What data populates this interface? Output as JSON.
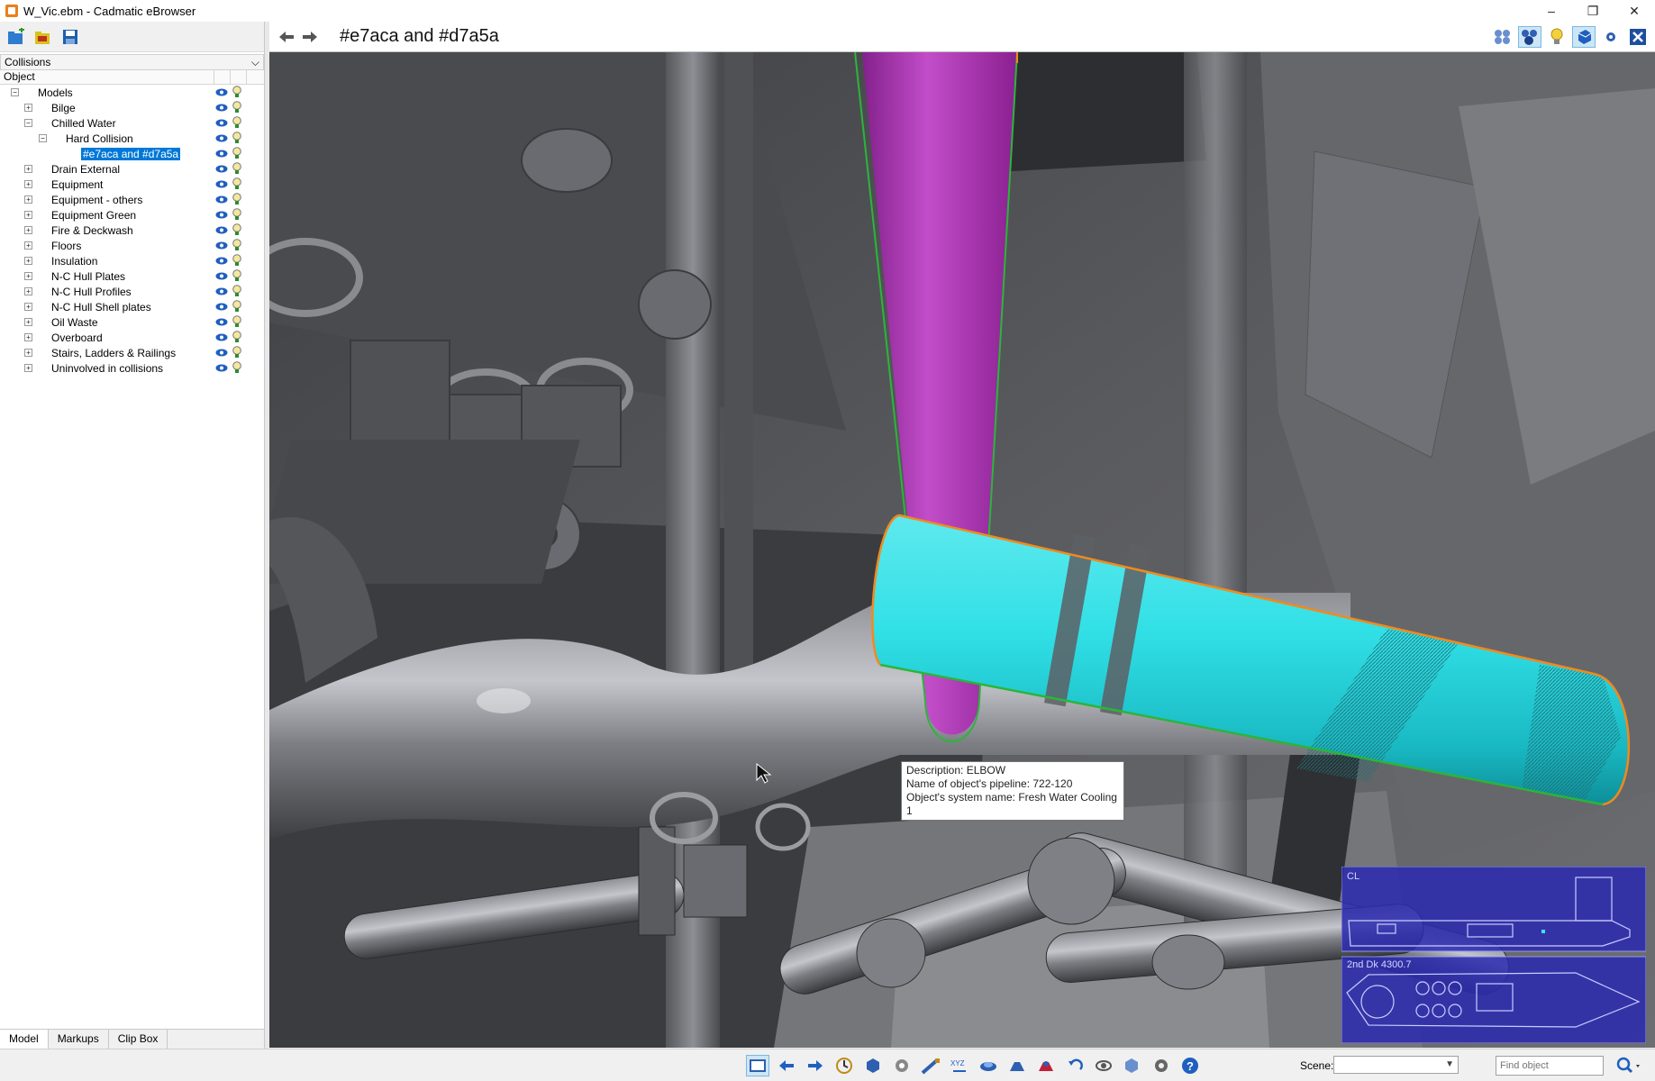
{
  "window": {
    "title": "W_Vic.ebm - Cadmatic eBrowser",
    "minimize": "–",
    "restore": "❐",
    "close": "✕"
  },
  "left_panel": {
    "dropdown_value": "Collisions",
    "column_header": "Object",
    "tree": [
      {
        "label": "Models",
        "level": 0,
        "expander": "−"
      },
      {
        "label": "Bilge",
        "level": 1,
        "expander": "+"
      },
      {
        "label": "Chilled Water",
        "level": 1,
        "expander": "−"
      },
      {
        "label": "Hard Collision",
        "level": 2,
        "expander": "−"
      },
      {
        "label": "#e7aca and #d7a5a",
        "level": 3,
        "expander": "",
        "selected": true
      },
      {
        "label": "Drain External",
        "level": 1,
        "expander": "+"
      },
      {
        "label": "Equipment",
        "level": 1,
        "expander": "+"
      },
      {
        "label": "Equipment - others",
        "level": 1,
        "expander": "+"
      },
      {
        "label": "Equipment Green",
        "level": 1,
        "expander": "+"
      },
      {
        "label": "Fire & Deckwash",
        "level": 1,
        "expander": "+"
      },
      {
        "label": "Floors",
        "level": 1,
        "expander": "+"
      },
      {
        "label": "Insulation",
        "level": 1,
        "expander": "+"
      },
      {
        "label": "N-C Hull Plates",
        "level": 1,
        "expander": "+"
      },
      {
        "label": "N-C Hull Profiles",
        "level": 1,
        "expander": "+"
      },
      {
        "label": "N-C Hull Shell plates",
        "level": 1,
        "expander": "+"
      },
      {
        "label": "Oil Waste",
        "level": 1,
        "expander": "+"
      },
      {
        "label": "Overboard",
        "level": 1,
        "expander": "+"
      },
      {
        "label": "Stairs, Ladders & Railings",
        "level": 1,
        "expander": "+"
      },
      {
        "label": "Uninvolved in collisions",
        "level": 1,
        "expander": "+"
      }
    ],
    "tabs": [
      "Model",
      "Markups",
      "Clip Box"
    ]
  },
  "view": {
    "title": "#e7aca and #d7a5a"
  },
  "tooltip": {
    "line1": "Description: ELBOW",
    "line2": "Name of object's pipeline: 722-120",
    "line3": "Object's system name: Fresh Water Cooling 1"
  },
  "minimap": {
    "label_top": "CL",
    "label_bottom": "2nd Dk  4300.7"
  },
  "status_bar": {
    "scene_label": "Scene:",
    "scene_value": "",
    "find_placeholder": "Find object"
  },
  "colors": {
    "selection": "#0078d7",
    "pipe_cyan": "#2fd9e0",
    "pipe_purple": "#a02aa8",
    "outline_orange": "#f08a1e",
    "outline_green": "#2bb53a",
    "minimap_bg": "#2b2ab0"
  },
  "icons": {
    "app": "cadmatic-logo-icon",
    "toolbar": [
      "open-model-icon",
      "open-markup-icon",
      "save-icon"
    ],
    "view_header": [
      "show-all-icon",
      "hide-others-icon",
      "light-icon",
      "cube-icon",
      "settings-icon",
      "close-view-icon"
    ]
  }
}
